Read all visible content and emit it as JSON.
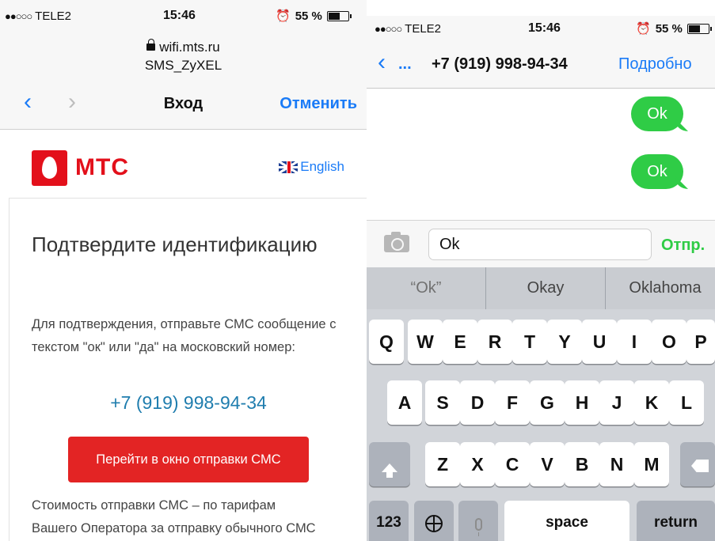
{
  "left": {
    "status": {
      "carrier_dots": "●●○○○",
      "carrier": "TELE2",
      "time": "15:46",
      "battery": "55 %"
    },
    "browser": {
      "url": "wifi.mts.ru",
      "page_host_title": "SMS_ZyXEL",
      "back": "‹",
      "forward": "›",
      "title": "Вход",
      "cancel": "Отменить"
    },
    "brand": {
      "name": "МТС",
      "language": "English"
    },
    "card": {
      "title": "Подтвердите идентификацию",
      "text": "Для подтверждения, отправьте СМС сообщение с текстом \"ок\" или \"да\" на московский номер:",
      "phone": "+7 (919) 998-94-34",
      "button": "Перейти в окно отправки СМС",
      "footer_line1": "Стоимость отправки СМС – по тарифам",
      "footer_line2": "Вашего Оператора за отправку обычного СМС"
    }
  },
  "right": {
    "status": {
      "carrier_dots": "●●○○○",
      "carrier": "TELE2",
      "time": "15:46",
      "battery": "55 %"
    },
    "header": {
      "back": "‹",
      "back_dots": "...",
      "contact": "+7 (919) 998-94-34",
      "details": "Подробно"
    },
    "messages": [
      {
        "text": "Ok"
      },
      {
        "text": "Ok"
      }
    ],
    "composer": {
      "value": "Ok",
      "send": "Отпр."
    },
    "suggestions": [
      "“Ok”",
      "Okay",
      "Oklahoma"
    ],
    "keys": {
      "row1": [
        "Q",
        "W",
        "E",
        "R",
        "T",
        "Y",
        "U",
        "I",
        "O",
        "P"
      ],
      "row2": [
        "A",
        "S",
        "D",
        "F",
        "G",
        "H",
        "J",
        "K",
        "L"
      ],
      "row3": [
        "Z",
        "X",
        "C",
        "V",
        "B",
        "N",
        "M"
      ],
      "numbers": "123",
      "space": "space",
      "return": "return"
    }
  }
}
